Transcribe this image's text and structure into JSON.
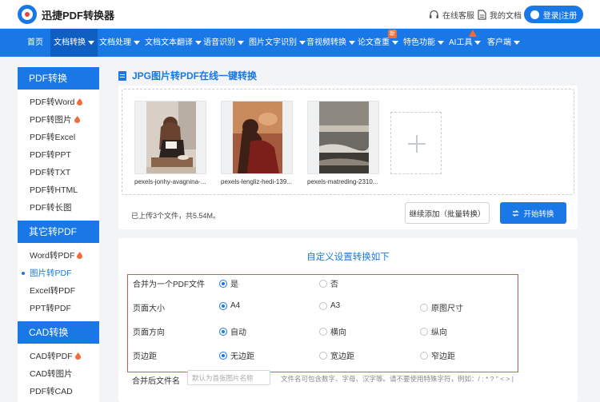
{
  "header": {
    "logo_text": "迅捷PDF转换器",
    "service_label": "在线客服",
    "docs_label": "我的文档",
    "login_label": "登录|注册"
  },
  "nav": {
    "items": [
      {
        "label": "首页",
        "has_caret": false
      },
      {
        "label": "文档转换",
        "has_caret": true,
        "active": true
      },
      {
        "label": "文档处理",
        "has_caret": true
      },
      {
        "label": "文档文本翻译",
        "has_caret": true
      },
      {
        "label": "语音识别",
        "has_caret": true
      },
      {
        "label": "图片文字识别",
        "has_caret": true
      },
      {
        "label": "音视频转换",
        "has_caret": true
      },
      {
        "label": "论文查重",
        "has_caret": true
      },
      {
        "label": "特色功能",
        "has_caret": true
      },
      {
        "label": "AI工具",
        "has_caret": true
      },
      {
        "label": "客户端",
        "has_caret": true
      }
    ],
    "new_badge": "新"
  },
  "sidebar": {
    "sections": [
      {
        "title": "PDF转换",
        "items": [
          {
            "label": "PDF转Word",
            "hot": true
          },
          {
            "label": "PDF转图片",
            "hot": true
          },
          {
            "label": "PDF转Excel",
            "hot": false
          },
          {
            "label": "PDF转PPT",
            "hot": false
          },
          {
            "label": "PDF转TXT",
            "hot": false
          },
          {
            "label": "PDF转HTML",
            "hot": false
          },
          {
            "label": "PDF转长图",
            "hot": false
          }
        ]
      },
      {
        "title": "其它转PDF",
        "items": [
          {
            "label": "Word转PDF",
            "hot": true
          },
          {
            "label": "图片转PDF",
            "hot": false,
            "active": true
          },
          {
            "label": "Excel转PDF",
            "hot": false
          },
          {
            "label": "PPT转PDF",
            "hot": false
          }
        ]
      },
      {
        "title": "CAD转换",
        "items": [
          {
            "label": "CAD转PDF",
            "hot": true
          },
          {
            "label": "CAD转图片",
            "hot": false
          },
          {
            "label": "PDF转CAD",
            "hot": false
          }
        ]
      }
    ]
  },
  "main": {
    "title": "JPG图片转PDF在线一键转换",
    "files": [
      {
        "name": "pexels-jonhy-avagnina-...",
        "photo": "woman-reading"
      },
      {
        "name": "pexels-lengliz-hedi-139...",
        "photo": "woman-red-coat"
      },
      {
        "name": "pexels-matreding-2310...",
        "photo": "seascape"
      }
    ],
    "upload_status": "已上传3个文件，共5.54M。",
    "add_more_label": "继续添加（批量转换）",
    "start_label": "开始转换"
  },
  "settings": {
    "title": "自定义设置转换如下",
    "rows": [
      {
        "label": "合并为一个PDF文件",
        "options": [
          {
            "label": "是",
            "checked": true
          },
          {
            "label": "否",
            "checked": false
          }
        ]
      },
      {
        "label": "页面大小",
        "options": [
          {
            "label": "A4",
            "checked": true
          },
          {
            "label": "A3",
            "checked": false
          },
          {
            "label": "原图尺寸",
            "checked": false
          }
        ]
      },
      {
        "label": "页面方向",
        "options": [
          {
            "label": "自动",
            "checked": true
          },
          {
            "label": "横向",
            "checked": false
          },
          {
            "label": "纵向",
            "checked": false
          }
        ]
      },
      {
        "label": "页边距",
        "options": [
          {
            "label": "无边距",
            "checked": true
          },
          {
            "label": "宽边距",
            "checked": false
          },
          {
            "label": "窄边距",
            "checked": false
          }
        ]
      }
    ],
    "filename_label": "合并后文件名",
    "filename_placeholder": "默认为首张图片名称",
    "filename_hint": "文件名可包含数字、字母、汉字等。请不要使用特殊字符，例如：/ : * ? \" < > |"
  },
  "colors": {
    "brand": "#1a78e6",
    "highlight_border": "#e05545",
    "hot": "#f26b3a"
  }
}
